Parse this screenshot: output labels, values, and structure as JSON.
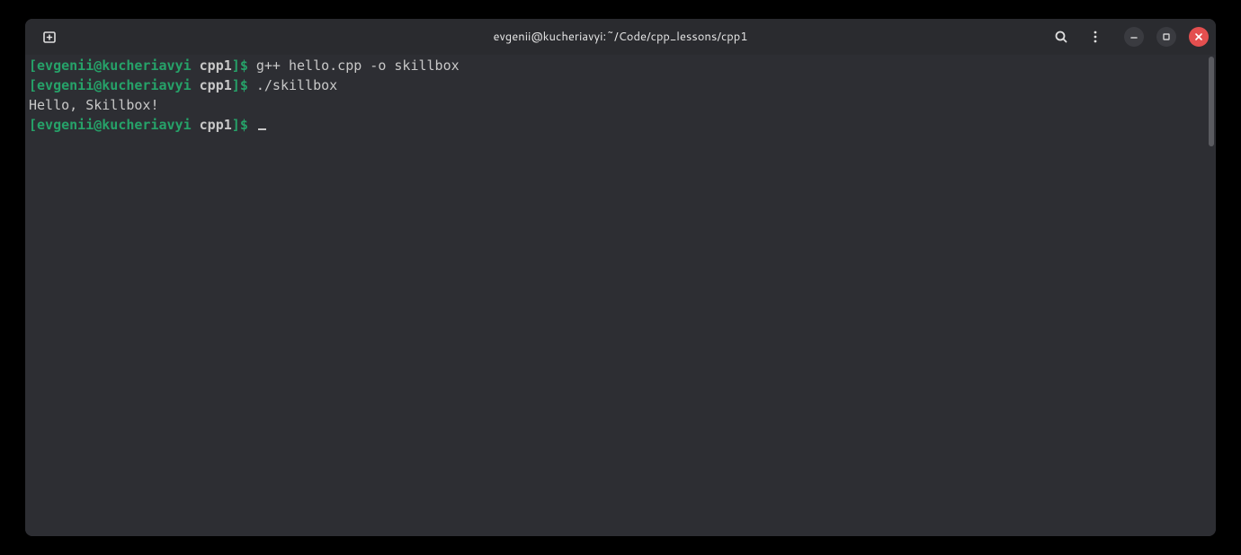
{
  "window": {
    "title": "evgenii@kucheriavyi:~/Code/cpp_lessons/cpp1"
  },
  "prompt": {
    "open_bracket": "[",
    "user": "evgenii",
    "at": "@",
    "host": "kucheriavyi",
    "dir": "cpp1",
    "close_bracket": "]",
    "dollar": "$"
  },
  "lines": [
    {
      "type": "cmd",
      "text": "g++ hello.cpp -o skillbox"
    },
    {
      "type": "cmd",
      "text": "./skillbox"
    },
    {
      "type": "out",
      "text": "Hello, Skillbox!"
    },
    {
      "type": "cmd",
      "text": ""
    }
  ]
}
